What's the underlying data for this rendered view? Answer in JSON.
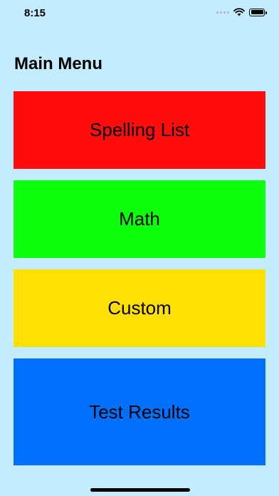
{
  "status_bar": {
    "time": "8:15",
    "icons": [
      "signal-dots-icon",
      "wifi-icon",
      "battery-icon"
    ]
  },
  "header": {
    "title": "Main Menu"
  },
  "menu": {
    "items": [
      {
        "label": "Spelling List",
        "color": "#ff0d0d"
      },
      {
        "label": "Math",
        "color": "#0cff0c"
      },
      {
        "label": "Custom",
        "color": "#ffe000"
      },
      {
        "label": "Test Results",
        "color": "#0070ff"
      }
    ]
  },
  "colors": {
    "background": "#c3ecfe"
  }
}
